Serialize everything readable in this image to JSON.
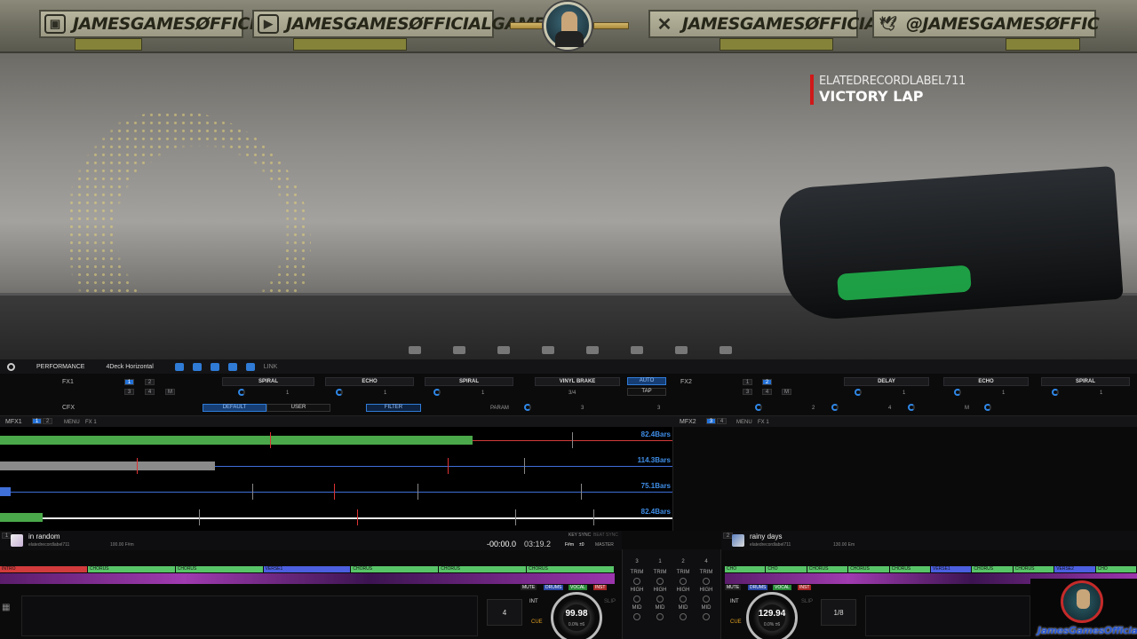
{
  "banner": {
    "twitch": "JAMESGAMESØFFICIAL",
    "youtube": "JAMESGAMESØFFICIALGAME",
    "x": "JAMESGAMESØFFICIAL",
    "twitter": "@JAMESGAMESØFFIC"
  },
  "now_playing": {
    "artist": "ELATEDRECORDLABEL711",
    "title": "VICTORY LAP"
  },
  "app": {
    "toolbar": {
      "mode": "PERFORMANCE",
      "layout": "4Deck Horizontal",
      "link": "LINK"
    },
    "fx1": {
      "label": "FX1",
      "pads": [
        "1",
        "2",
        "3",
        "4",
        "M"
      ],
      "slots": [
        "SPIRAL",
        "ECHO",
        "SPIRAL",
        "VINYL BRAKE"
      ],
      "values": [
        "1",
        "1",
        "1",
        "3/4"
      ],
      "auto": "AUTO",
      "tap": "TAP"
    },
    "fx2": {
      "label": "FX2",
      "pads": [
        "1",
        "2",
        "3",
        "4",
        "M"
      ],
      "slots": [
        "DELAY",
        "ECHO",
        "SPIRAL"
      ],
      "values": [
        "1",
        "1",
        "1"
      ],
      "beats": [
        "2",
        "4",
        "M"
      ]
    },
    "cfx": {
      "label": "CFX",
      "default": "DEFAULT",
      "user": "USER",
      "filter": "FILTER",
      "param": "PARAM",
      "v1": "3",
      "v2": "3"
    },
    "mfx1": {
      "label": "MFX1",
      "pads": [
        "1",
        "2"
      ],
      "menu": "MENU",
      "fx": "FX 1"
    },
    "mfx2": {
      "label": "MFX2",
      "pads": [
        "3",
        "4"
      ],
      "menu": "MENU",
      "fx": "FX 1"
    },
    "overview": [
      {
        "bars": "82.4Bars",
        "color": "#d23b3b",
        "fill": "#4aa84a"
      },
      {
        "bars": "114.3Bars",
        "color": "#3f6fd8",
        "fill": "#8a8a8a"
      },
      {
        "bars": "75.1Bars",
        "color": "#3f6fd8",
        "fill": "#3f6fd8"
      },
      {
        "bars": "82.4Bars",
        "color": "#e8e8e8",
        "fill": "#4aa84a"
      }
    ],
    "deck_left": {
      "number": "1",
      "title": "in random",
      "artist": "elatedrecordlabel711",
      "bpm_key": "100.00  F#m",
      "elapsed": "-00:00.0",
      "remaining": "03:19.2",
      "key_sync": "KEY SYNC",
      "key": "F#m",
      "key_val": "±0",
      "beat_sync": "BEAT SYNC",
      "master": "MASTER",
      "phrases": [
        "INTRO",
        "CHORUS",
        "CHORUS",
        "VERSE1",
        "CHORUS",
        "CHORUS",
        "CHORUS"
      ],
      "stems": [
        "MUTE",
        "DRUMS",
        "VOCAL",
        "INST"
      ],
      "int": "INT",
      "beatjump": "4",
      "bpm": "99.98",
      "pct": "0.0%  ±6",
      "slip": "SLIP",
      "cue": "CUE"
    },
    "deck_right": {
      "number": "2",
      "title": "rainy days",
      "artist": "elatedrecordlabel711",
      "bpm_key": "130.00  Em",
      "phrases": [
        "CHO",
        "CHO",
        "CHORUS",
        "CHORUS",
        "CHORUS",
        "VERSE1",
        "CHORUS",
        "CHORUS",
        "VERSE2",
        "CHO"
      ],
      "stems": [
        "MUTE",
        "DRUMS",
        "VOCAL",
        "INST"
      ],
      "int": "INT",
      "beatjump": "1/8",
      "bpm": "129.94",
      "pct": "0.0%  ±6",
      "slip": "SLIP",
      "cue": "CUE"
    },
    "mixer": {
      "channels": [
        "3",
        "1",
        "2",
        "4"
      ],
      "rows": [
        "TRIM",
        "HIGH",
        "MID"
      ],
      "trim": "TRIM"
    }
  },
  "watermark": "JamesGamesOfficial"
}
